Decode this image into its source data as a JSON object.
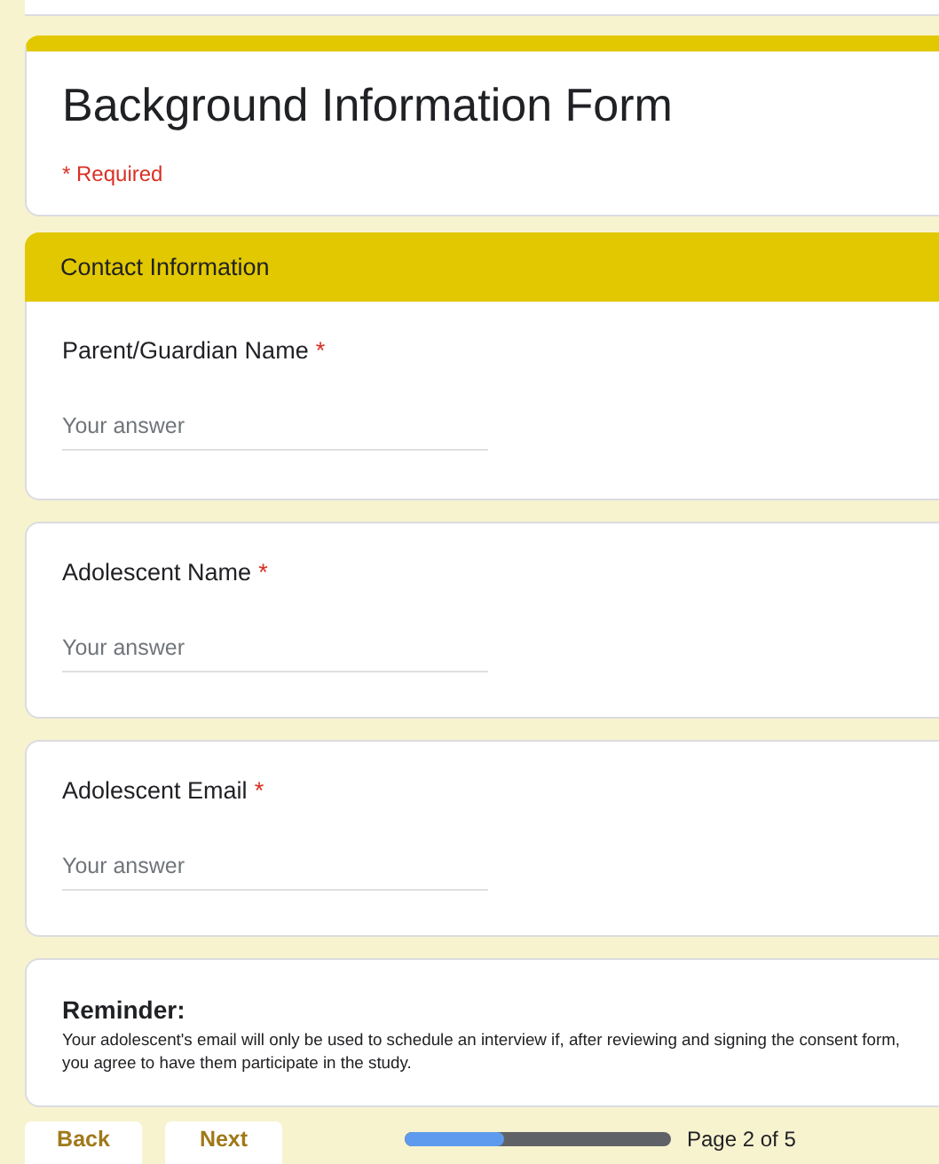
{
  "form": {
    "title": "Background Information Form",
    "required_note": "* Required"
  },
  "section": {
    "title": "Contact Information"
  },
  "questions": [
    {
      "label": "Parent/Guardian Name",
      "required_mark": "*",
      "placeholder": "Your answer"
    },
    {
      "label": "Adolescent Name",
      "required_mark": "*",
      "placeholder": "Your answer"
    },
    {
      "label": "Adolescent Email",
      "required_mark": "*",
      "placeholder": "Your answer"
    }
  ],
  "reminder": {
    "title": "Reminder:",
    "text": "Your adolescent's email will only be used to schedule an interview if, after reviewing and signing the consent form, you agree to have them participate in the study."
  },
  "buttons": [
    "Back",
    "Next"
  ],
  "progress": {
    "level": 0.37,
    "label": "Page 2 of 5"
  }
}
